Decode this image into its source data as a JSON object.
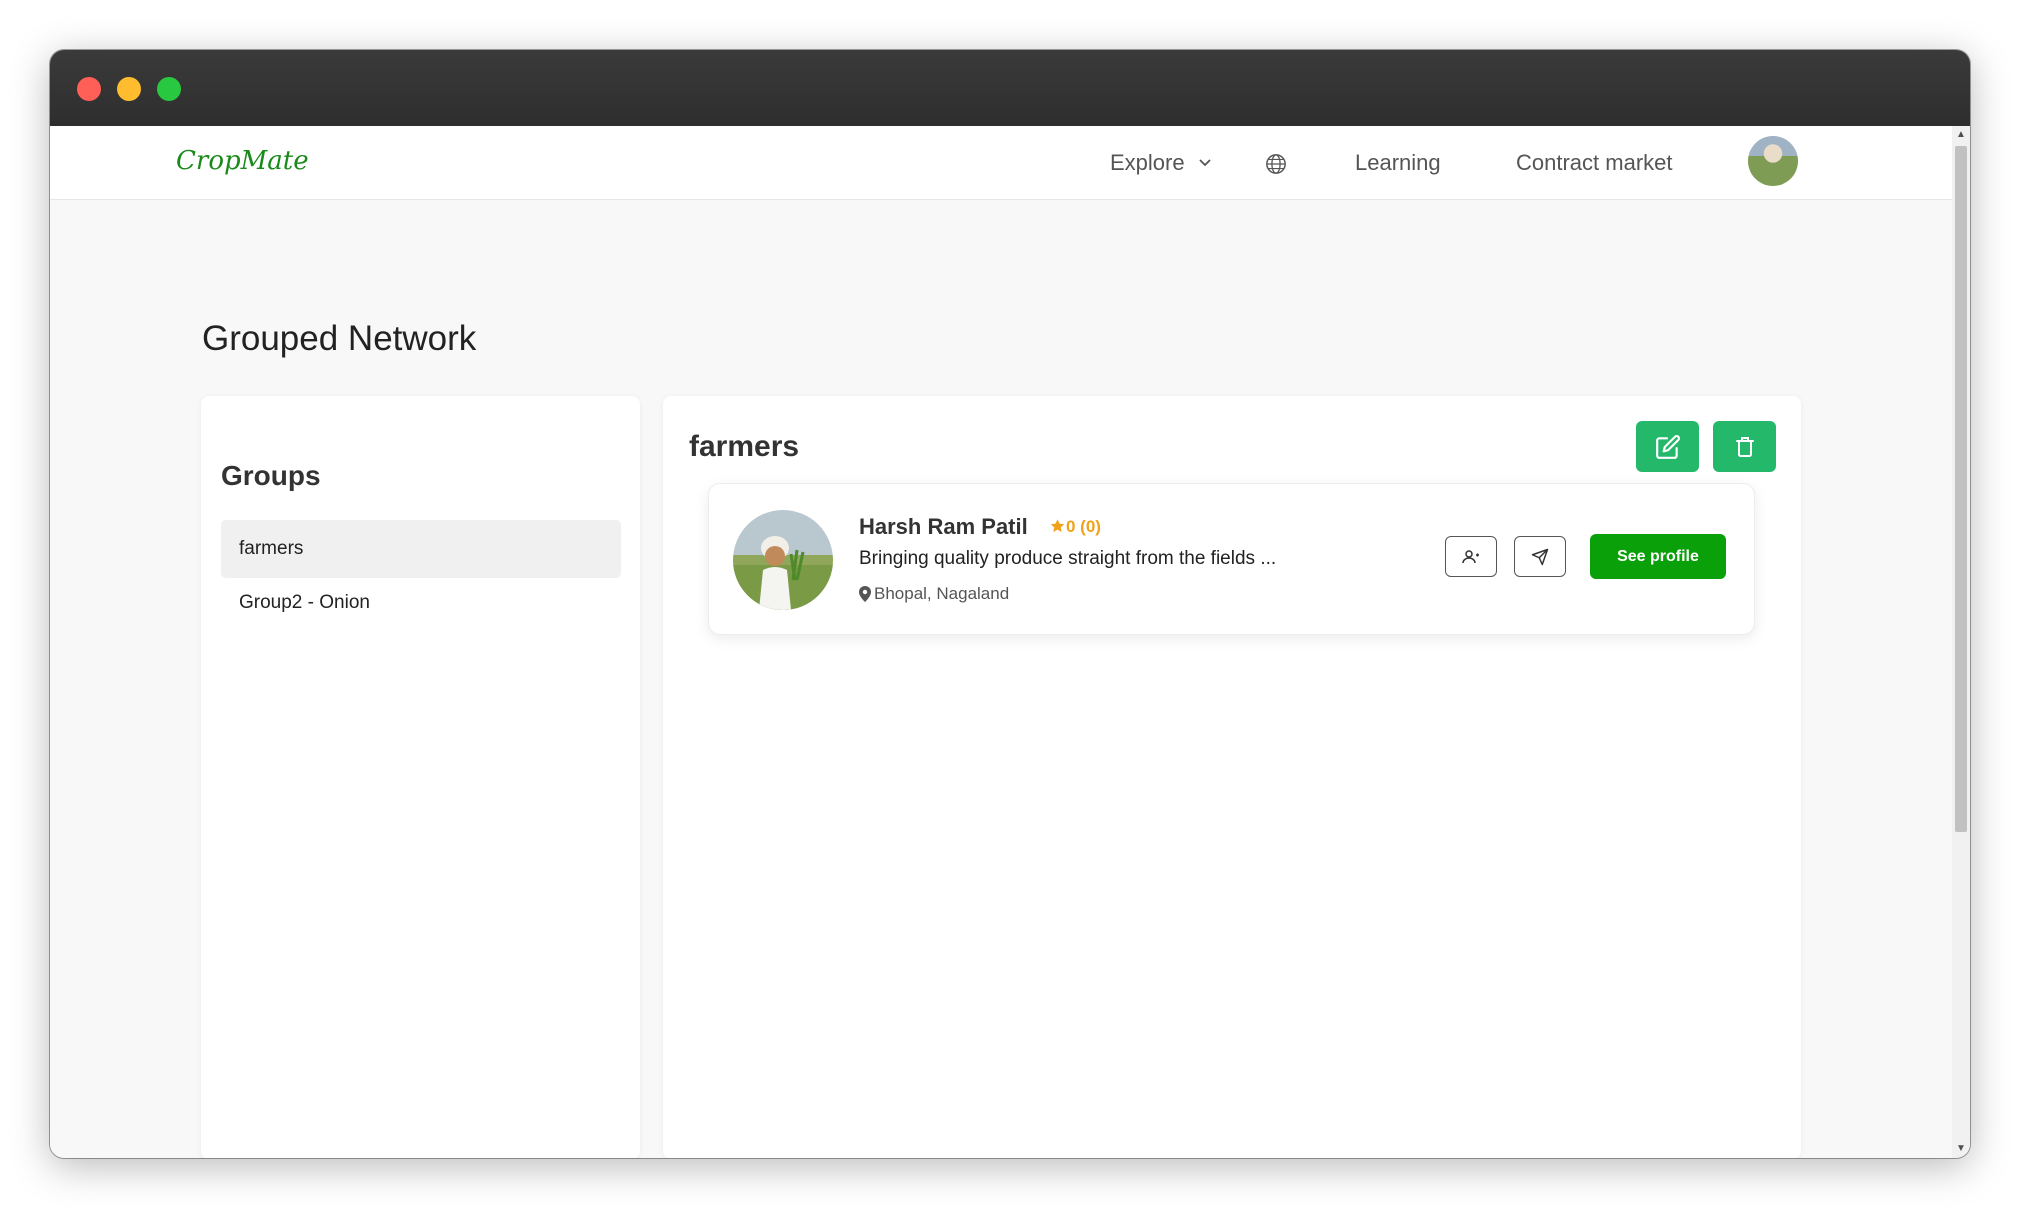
{
  "navbar": {
    "logo": "CropMate",
    "explore_label": "Explore",
    "learning_label": "Learning",
    "contract_label": "Contract market"
  },
  "page": {
    "title": "Grouped Network"
  },
  "groups": {
    "heading": "Groups",
    "items": [
      {
        "label": "farmers",
        "active": true
      },
      {
        "label": "Group2 - Onion",
        "active": false
      }
    ]
  },
  "main": {
    "group_name": "farmers",
    "members": [
      {
        "name": "Harsh Ram Patil",
        "rating_text": "0 (0)",
        "bio": "Bringing quality produce straight from the fields ...",
        "location": "Bhopal, Nagaland",
        "see_profile_label": "See profile"
      }
    ]
  },
  "colors": {
    "brand_green": "#1a8a1a",
    "action_green": "#24b86a",
    "profile_button_green": "#0aa00a",
    "rating_orange": "#f0a21a"
  },
  "icons": {
    "explore": "chevron-down-icon",
    "language": "globe-icon",
    "edit": "edit-icon",
    "delete": "trash-icon",
    "rating": "star-icon",
    "location": "map-pin-icon",
    "add_contact": "user-add-icon",
    "send": "send-icon"
  }
}
